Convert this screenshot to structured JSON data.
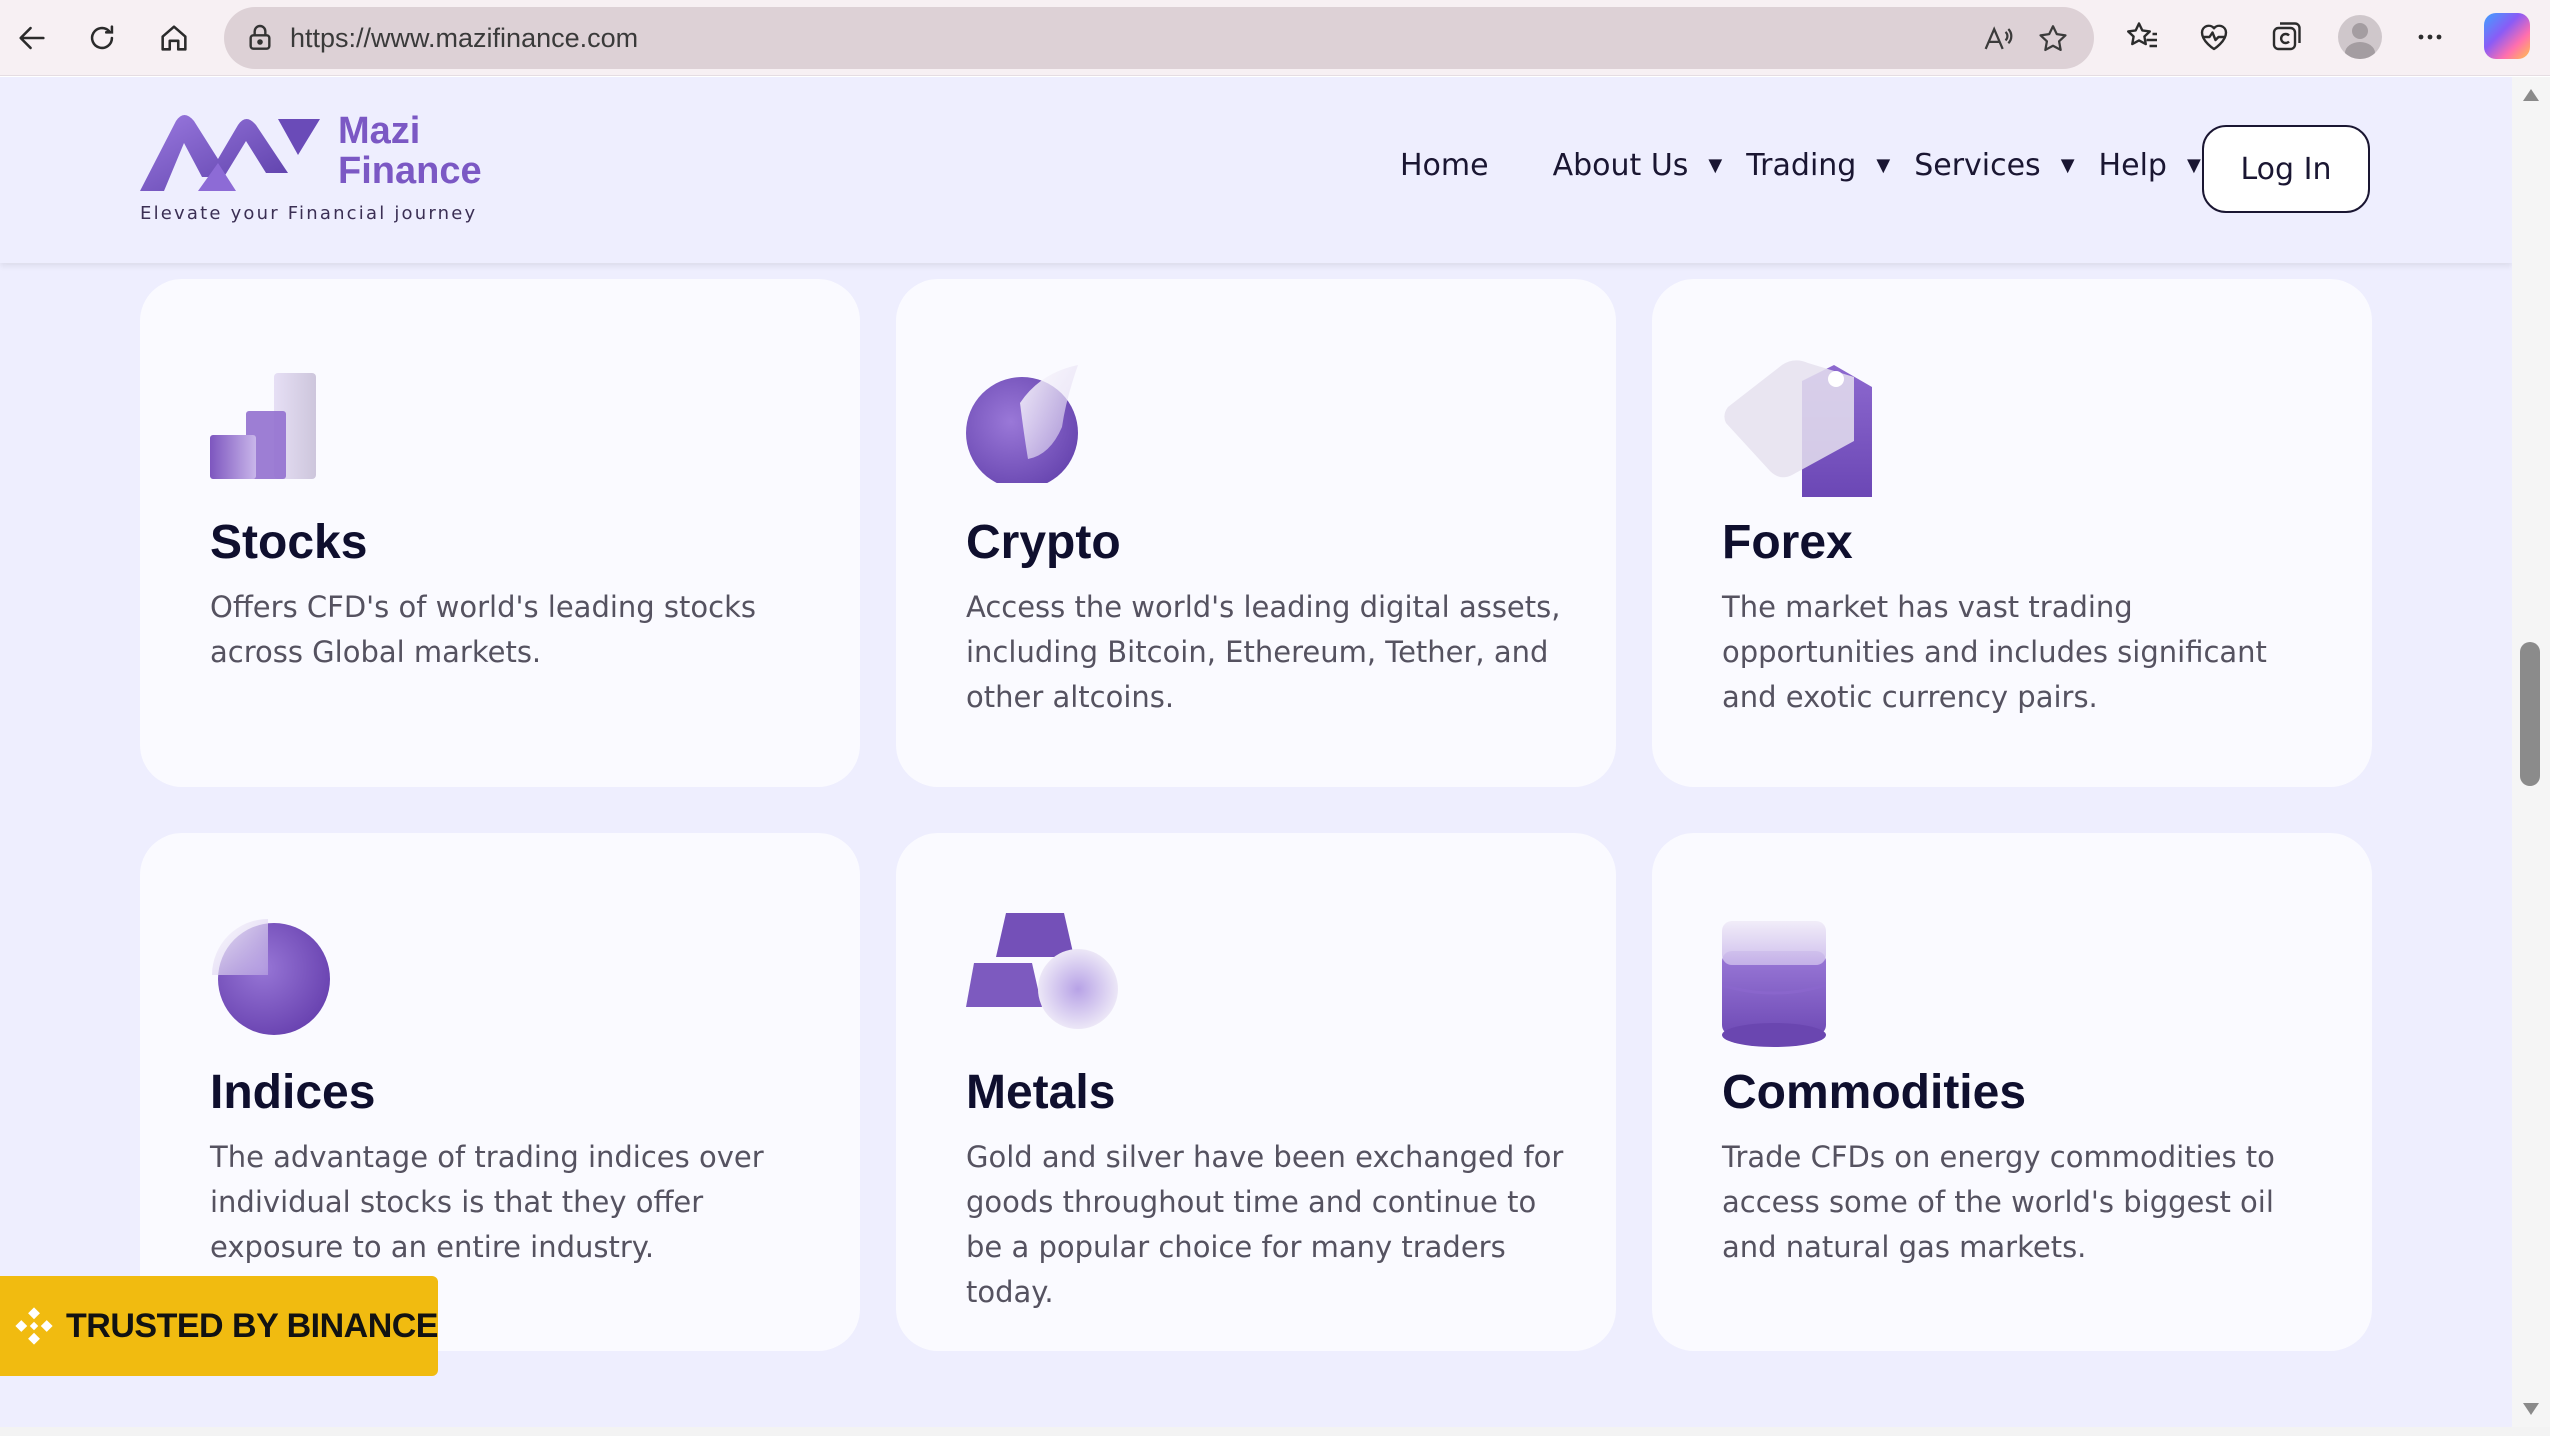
{
  "browser": {
    "url": "https://www.mazifinance.com"
  },
  "header": {
    "logo_name_line1": "Mazi",
    "logo_name_line2": "Finance",
    "logo_tagline": "Elevate your Financial journey",
    "nav": [
      {
        "label": "Home",
        "dropdown": false
      },
      {
        "label": "About Us",
        "dropdown": true
      },
      {
        "label": "Trading",
        "dropdown": true
      },
      {
        "label": "Services",
        "dropdown": true
      },
      {
        "label": "Help",
        "dropdown": true
      }
    ],
    "login_label": "Log In"
  },
  "cards": [
    {
      "title": "Stocks",
      "icon": "bar-steps-icon",
      "description": "Offers CFD's of world's leading stocks across Global markets."
    },
    {
      "title": "Crypto",
      "icon": "crypto-coin-icon",
      "description": "Access the world's leading digital assets, including Bitcoin, Ethereum, Tether, and other altcoins."
    },
    {
      "title": "Forex",
      "icon": "price-tag-icon",
      "description": "The market has vast trading opportunities and includes significant and exotic currency pairs."
    },
    {
      "title": "Indices",
      "icon": "pie-chart-icon",
      "description": "The advantage of trading indices over individual stocks is that they offer exposure to an entire industry."
    },
    {
      "title": "Metals",
      "icon": "gold-bars-icon",
      "description": "Gold and silver have been exchanged for goods throughout time and continue to be a popular choice for many traders today."
    },
    {
      "title": "Commodities",
      "icon": "barrel-icon",
      "description": "Trade CFDs on energy commodities to access some of the world's biggest oil and natural gas markets."
    }
  ],
  "badge": {
    "label": "TRUSTED BY BINANCE"
  },
  "colors": {
    "page_background": "#eeeefe",
    "card_background": "#fafaff",
    "brand_purple": "#7b58c4",
    "badge_yellow": "#f1bb10",
    "heading_text": "#0f0f2e"
  }
}
